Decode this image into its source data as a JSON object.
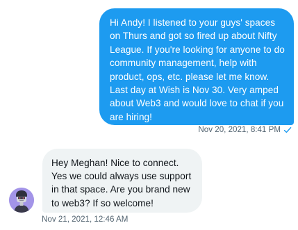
{
  "colors": {
    "outgoing_bubble": "#1d9bf0",
    "incoming_bubble": "#eff3f4",
    "meta_text": "#536471",
    "read_check": "#1d9bf0"
  },
  "conversation": {
    "messages": [
      {
        "direction": "outgoing",
        "lines": [
          "Hi Andy! I listened to your guys' spaces",
          "on Thurs and got so fired up about Nifty",
          "League. If you're looking for anyone to do",
          "community management, help with",
          "product, ops, etc. please let me know.",
          "Last day at Wish is Nov 30. Very amped",
          "about Web3 and would love to chat if you",
          "are hiring!"
        ],
        "timestamp": "Nov 20, 2021, 8:41 PM",
        "status_icon": "check-icon"
      },
      {
        "direction": "incoming",
        "avatar_icon": "avatar-icon",
        "lines": [
          "Hey Meghan! Nice to connect.",
          "Yes we could always use support",
          "in that space. Are you brand new",
          "to web3? If so welcome!"
        ],
        "timestamp": "Nov 21, 2021, 12:46 AM"
      }
    ]
  }
}
